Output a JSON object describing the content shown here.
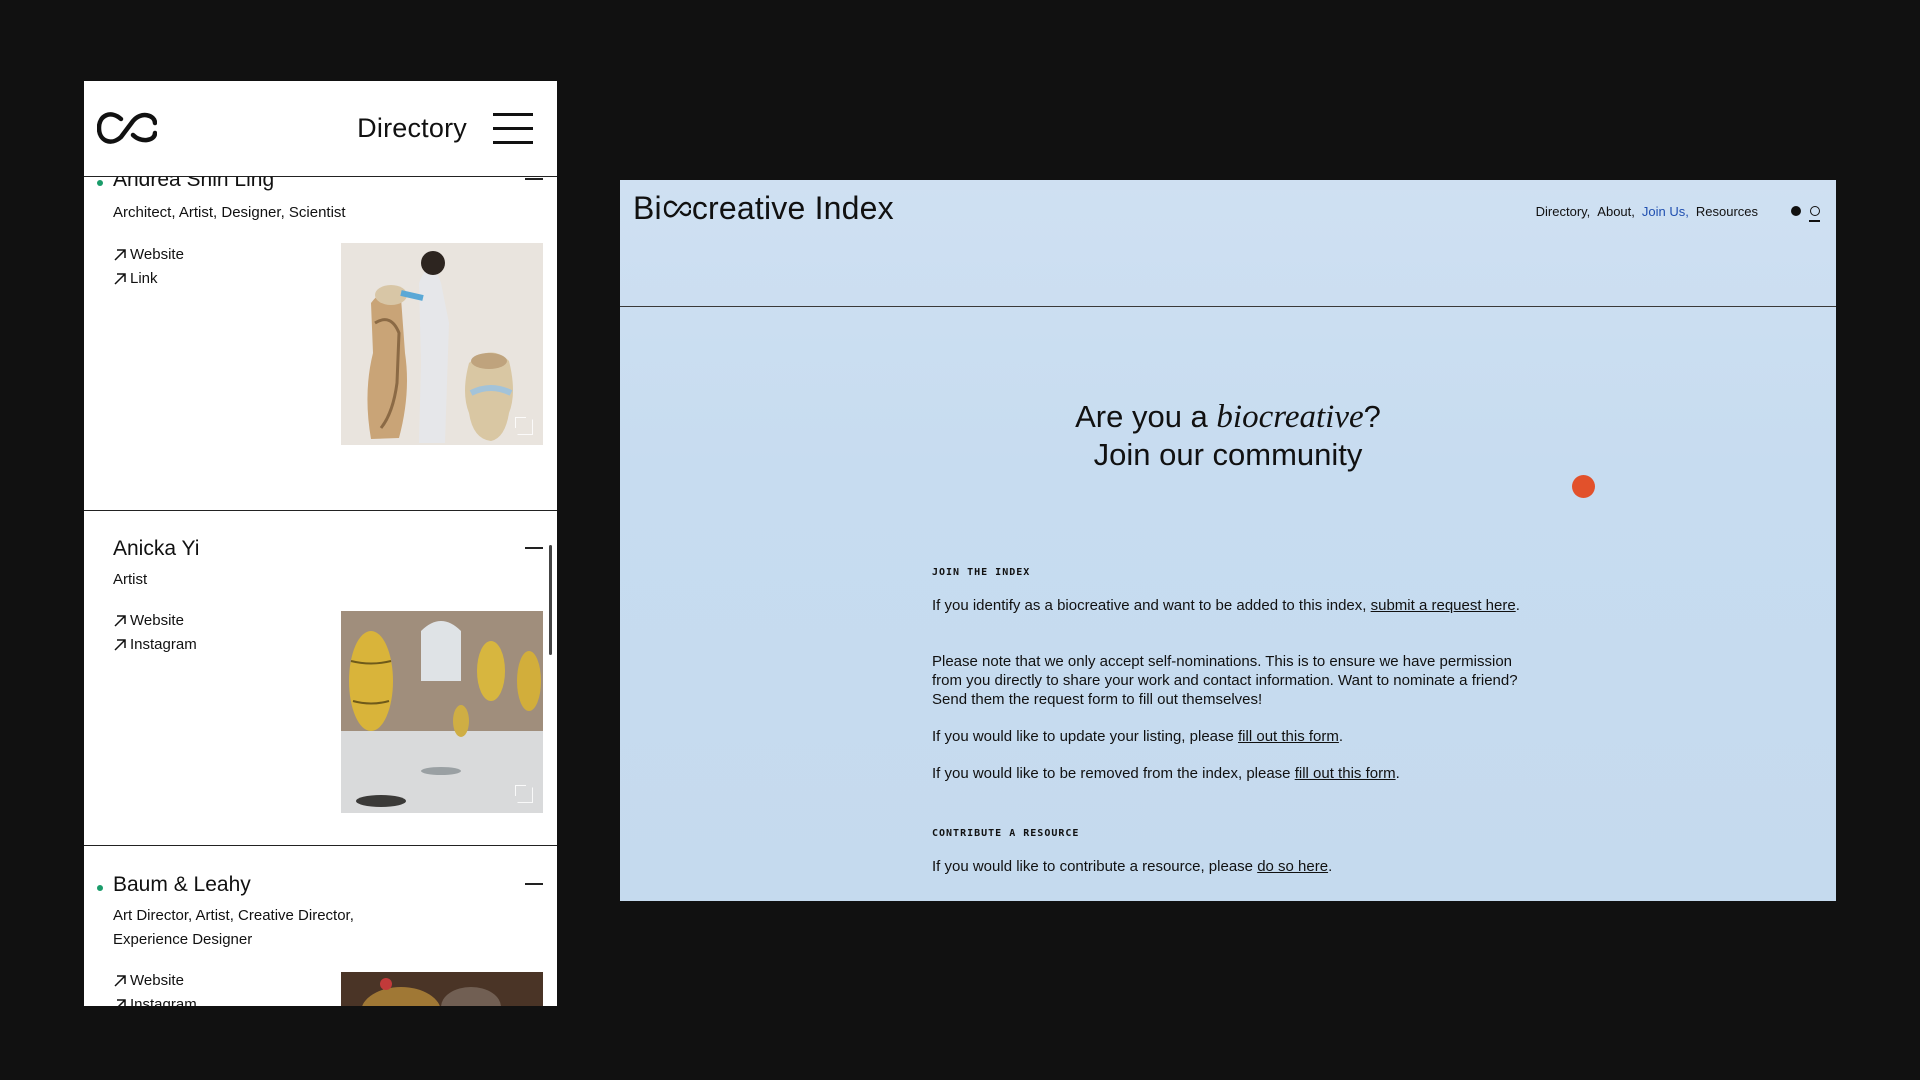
{
  "mobile": {
    "header": {
      "title": "Directory"
    },
    "entries": [
      {
        "name": "Andrea Shin Ling",
        "roles": "Architect, Artist, Designer, Scientist",
        "links": [
          "Website",
          "Link"
        ]
      },
      {
        "name": "Anicka Yi",
        "roles": "Artist",
        "links": [
          "Website",
          "Instagram"
        ]
      },
      {
        "name": "Baum & Leahy",
        "roles": "Art Director, Artist, Creative Director, Experience Designer",
        "links": [
          "Website",
          "Instagram"
        ]
      }
    ]
  },
  "desktop": {
    "brand": {
      "pre": "Bi",
      "post": "creative Index"
    },
    "nav": [
      "Directory,",
      "About,",
      "Join Us,",
      "Resources"
    ],
    "hero": {
      "line1_pre": "Are you a ",
      "line1_em": "biocreative",
      "line1_post": "?",
      "line2": "Join our community"
    },
    "join": {
      "heading": "JOIN THE INDEX",
      "p1_text": "If you identify as a biocreative and want to be added to this index, ",
      "p1_link": "submit a request here",
      "p1_end": ".",
      "p2": "Please note that we only accept self-nominations. This is to ensure we have permission from you directly to share your work and contact information. Want to nominate a friend? Send them the request form to fill out themselves!",
      "p3_text": "If you would like to update your listing, please ",
      "p3_link": "fill out this form",
      "p3_end": ".",
      "p4_text": "If you would like to be removed from the index, please ",
      "p4_link": "fill out this form",
      "p4_end": "."
    },
    "contribute": {
      "heading": "CONTRIBUTE A RESOURCE",
      "p1_text": "If you would like to contribute a resource, please ",
      "p1_link": "do so here",
      "p1_end": "."
    }
  },
  "colors": {
    "page_bg": "#111111",
    "desktop_bg": "#c9ddf0",
    "accent_link": "#1f4fb0",
    "cursor_dot": "#e2512b",
    "entry_dot": "#1a9c6a"
  }
}
